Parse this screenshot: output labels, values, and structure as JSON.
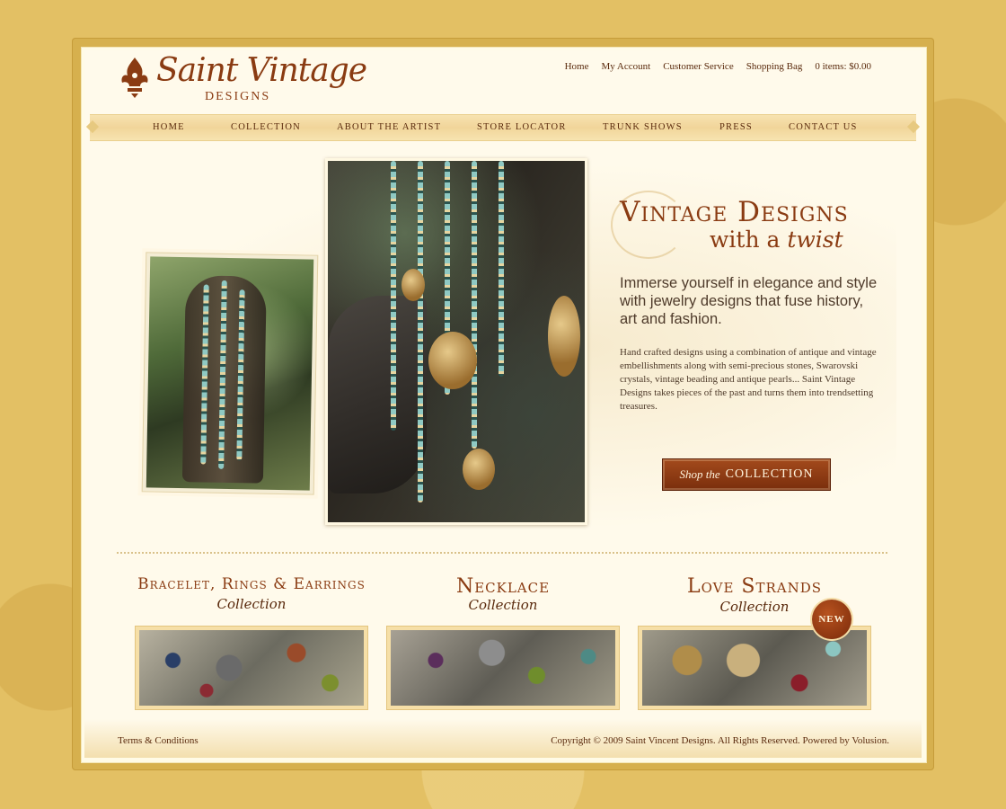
{
  "brand": {
    "logo_script": "Saint Vintage",
    "logo_sub": "DESIGNS"
  },
  "util_links": {
    "home": "Home",
    "my_account": "My Account",
    "customer_service": "Customer Service",
    "shopping_bag": "Shopping Bag",
    "cart_summary": "0 items: $0.00"
  },
  "nav": {
    "items": [
      "HOME",
      "COLLECTION",
      "ABOUT THE ARTIST",
      "STORE LOCATOR",
      "TRUNK SHOWS",
      "PRESS",
      "CONTACT US"
    ]
  },
  "hero": {
    "headline_line1": "Vintage Designs",
    "headline_line2_prefix": "with a",
    "headline_line2_emph": "twist",
    "lead": "Immerse yourself in elegance and style with jewelry designs that fuse history, art and fashion.",
    "body": "Hand crafted designs using a combination of antique and vintage embellishments along with semi-precious stones, Swarovski crystals, vintage beading and antique pearls... Saint Vintage Designs takes pieces of the past and turns them into trendsetting treasures.",
    "cta_script": "Shop the",
    "cta_caps": "COLLECTION"
  },
  "collections": [
    {
      "title": "Bracelet, Rings & Earrings",
      "sub": "Collection"
    },
    {
      "title": "Necklace",
      "sub": "Collection"
    },
    {
      "title": "Love Strands",
      "sub": "Collection",
      "badge": "NEW"
    }
  ],
  "footer": {
    "terms": "Terms & Conditions",
    "copyright": "Copyright © 2009 Saint Vincent Designs. All Rights Reserved. Powered by Volusion."
  },
  "colors": {
    "brand_brown": "#8a3b12",
    "background_gold": "#e3c064",
    "cta_red": "#7a2e0c"
  },
  "icons": {
    "logo_mark": "fleur-ornament-icon"
  }
}
